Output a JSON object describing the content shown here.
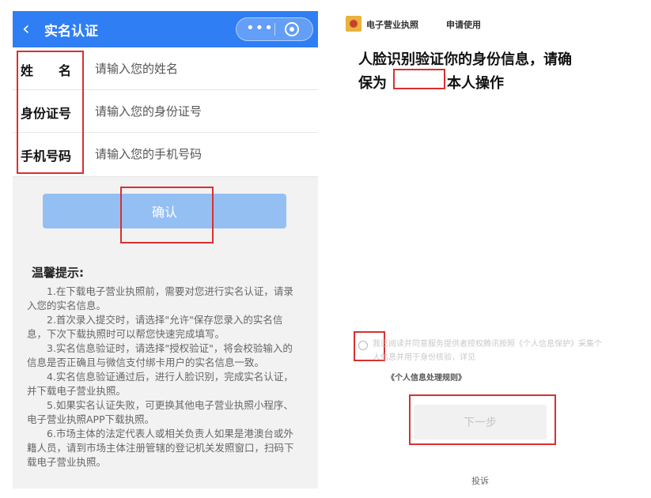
{
  "left": {
    "header": {
      "back_icon": "chevron-left-icon",
      "title": "实名认证",
      "more_icon_glyph": "•••",
      "close_icon": "target-circle-icon",
      "bg_color": "#2f7ef4"
    },
    "form": {
      "name": {
        "label": "姓　　名",
        "placeholder": "请输入您的姓名"
      },
      "id_number": {
        "label": "身份证号",
        "placeholder": "请输入您的身份证号"
      },
      "phone": {
        "label": "手机号码",
        "placeholder": "请输入您的手机号码"
      }
    },
    "confirm_label": "确认",
    "tips": {
      "title": "温馨提示:",
      "items": [
        "1.在下载电子营业执照前，需要对您进行实名认证，请录入您的实名信息。",
        "2.首次录入提交时，请选择\"允许\"保存您录入的实名信息，下次下载执照时可以帮您快速完成填写。",
        "3.实名信息验证时，请选择\"授权验证\"，将会校验输入的信息是否正确且与微信支付绑卡用户的实名信息一致。",
        "4.实名信息验证通过后，进行人脸识别，完成实名认证，并下载电子营业执照。",
        "5.如果实名认证失败，可更换其他电子营业执照小程序、电子营业执照APP下载执照。",
        "6.市场主体的法定代表人或相关负责人如果是港澳台或外籍人员，请到市场主体注册管辖的登记机关发照窗口，扫码下载电子营业执照。"
      ]
    }
  },
  "right": {
    "app_name": "电子营业执照",
    "app_request": "申请使用",
    "heading_line1": "人脸识别验证你的身份信息，请确",
    "heading_line2_prefix": "保为",
    "heading_line2_suffix": "本人操作",
    "consent_text": "我已阅读并同意服务提供者授权腾讯按照《个人信息保护》采集个人信息并用于身份核验，详见",
    "consent_link": "《个人信息处理规则》",
    "next_label": "下一步",
    "complaint_label": "投诉"
  },
  "colors": {
    "highlight": "#d93030",
    "confirm_button": "#94bff3",
    "page_bg": "#f2f2f2"
  }
}
